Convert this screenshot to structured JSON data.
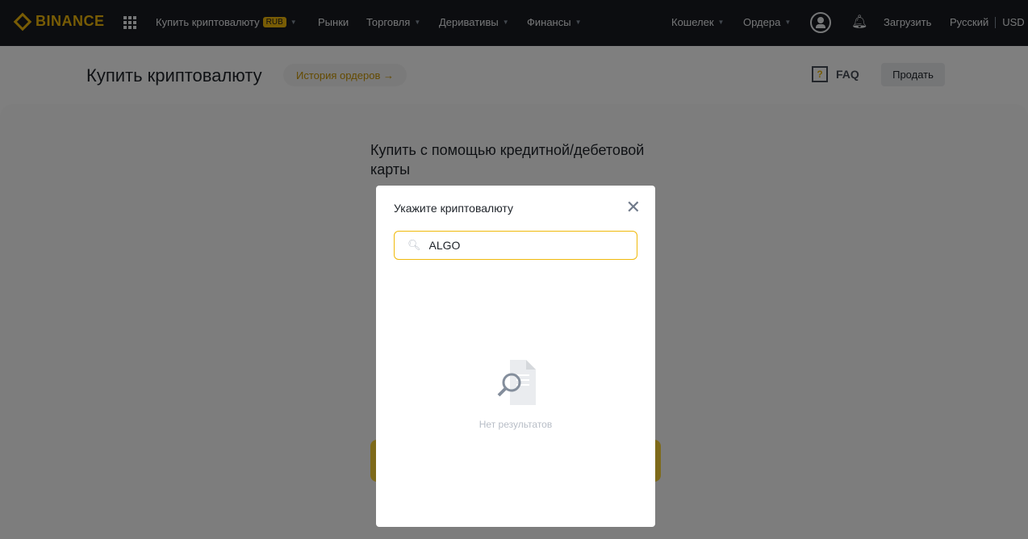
{
  "header": {
    "logo": "BINANCE",
    "nav": [
      {
        "label": "Купить криптовалюту",
        "badge": "RUB"
      },
      {
        "label": "Рынки"
      },
      {
        "label": "Торговля"
      },
      {
        "label": "Деривативы"
      },
      {
        "label": "Финансы"
      }
    ],
    "right": {
      "wallet": "Кошелек",
      "orders": "Ордера",
      "download": "Загрузить",
      "language": "Русский",
      "currency": "USD"
    }
  },
  "page": {
    "title": "Купить криптовалюту",
    "history": "История ордеров →",
    "faq": "FAQ",
    "faq_icon": "?",
    "sell": "Продать",
    "card_title": "Купить с помощью кредитной/дебетовой карты"
  },
  "modal": {
    "title": "Укажите криптовалюту",
    "close": "✕",
    "search_value": "ALGO",
    "empty": "Нет результатов"
  },
  "colors": {
    "accent": "#f0b90b",
    "header": "#181a20"
  }
}
